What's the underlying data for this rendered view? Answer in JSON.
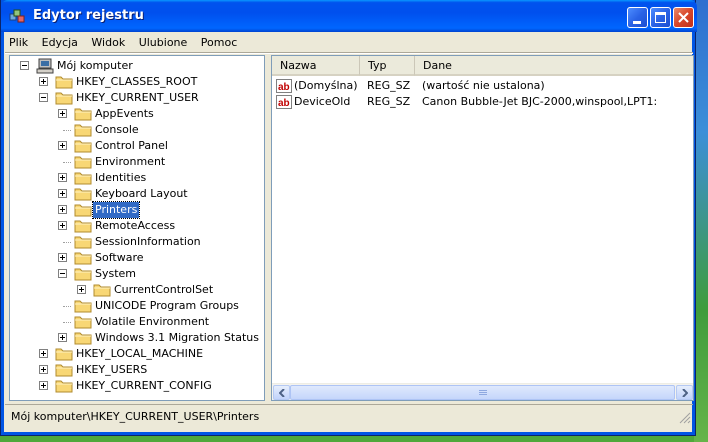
{
  "window": {
    "title": "Edytor rejestru"
  },
  "menu": {
    "items": [
      "Plik",
      "Edycja",
      "Widok",
      "Ulubione",
      "Pomoc"
    ]
  },
  "tree": {
    "root": "Mój komputer",
    "items": [
      {
        "label": "HKEY_CLASSES_ROOT",
        "level": 1,
        "expander": "plus"
      },
      {
        "label": "HKEY_CURRENT_USER",
        "level": 1,
        "expander": "minus"
      },
      {
        "label": "AppEvents",
        "level": 2,
        "expander": "plus"
      },
      {
        "label": "Console",
        "level": 2,
        "expander": "none"
      },
      {
        "label": "Control Panel",
        "level": 2,
        "expander": "plus"
      },
      {
        "label": "Environment",
        "level": 2,
        "expander": "none"
      },
      {
        "label": "Identities",
        "level": 2,
        "expander": "plus"
      },
      {
        "label": "Keyboard Layout",
        "level": 2,
        "expander": "plus"
      },
      {
        "label": "Printers",
        "level": 2,
        "expander": "plus",
        "selected": true
      },
      {
        "label": "RemoteAccess",
        "level": 2,
        "expander": "plus"
      },
      {
        "label": "SessionInformation",
        "level": 2,
        "expander": "none"
      },
      {
        "label": "Software",
        "level": 2,
        "expander": "plus"
      },
      {
        "label": "System",
        "level": 2,
        "expander": "minus"
      },
      {
        "label": "CurrentControlSet",
        "level": 3,
        "expander": "plus"
      },
      {
        "label": "UNICODE Program Groups",
        "level": 2,
        "expander": "none"
      },
      {
        "label": "Volatile Environment",
        "level": 2,
        "expander": "none"
      },
      {
        "label": "Windows 3.1 Migration Status",
        "level": 2,
        "expander": "plus"
      },
      {
        "label": "HKEY_LOCAL_MACHINE",
        "level": 1,
        "expander": "plus"
      },
      {
        "label": "HKEY_USERS",
        "level": 1,
        "expander": "plus"
      },
      {
        "label": "HKEY_CURRENT_CONFIG",
        "level": 1,
        "expander": "plus"
      }
    ]
  },
  "list": {
    "columns": [
      "Nazwa",
      "Typ",
      "Dane"
    ],
    "rows": [
      {
        "name": "(Domyślna)",
        "type": "REG_SZ",
        "data": "(wartość nie ustalona)"
      },
      {
        "name": "DeviceOld",
        "type": "REG_SZ",
        "data": "Canon Bubble-Jet BJC-2000,winspool,LPT1:"
      }
    ]
  },
  "statusbar": {
    "path": "Mój komputer\\HKEY_CURRENT_USER\\Printers"
  },
  "colors": {
    "selection": "#316ac5",
    "folder": "#f8d775",
    "titlebar": "#0053ee"
  }
}
